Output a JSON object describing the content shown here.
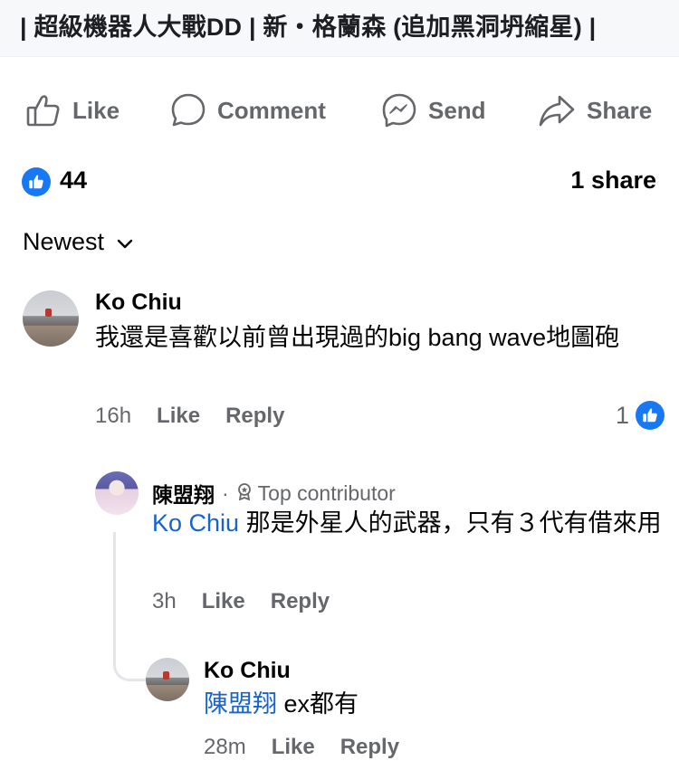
{
  "post": {
    "title": "| 超級機器人大戰DD | 新・格蘭森 (追加黑洞坍縮星) |"
  },
  "actions": {
    "like": "Like",
    "comment": "Comment",
    "send": "Send",
    "share": "Share"
  },
  "stats": {
    "reactions": "44",
    "shares": "1 share"
  },
  "sort": {
    "label": "Newest"
  },
  "comments": [
    {
      "author": "Ko Chiu",
      "text": "我還是喜歡以前曾出現過的big bang wave地圖砲",
      "time": "16h",
      "like": "Like",
      "reply": "Reply",
      "reactions": "1"
    },
    {
      "author": "陳盟翔",
      "separator": "·",
      "badge": "Top contributor",
      "mention": "Ko Chiu",
      "text": " 那是外星人的武器，只有３代有借來用",
      "time": "3h",
      "like": "Like",
      "reply": "Reply"
    },
    {
      "author": "Ko Chiu",
      "mention": "陳盟翔",
      "text": " ex都有",
      "time": "28m",
      "like": "Like",
      "reply": "Reply"
    }
  ],
  "colors": {
    "accent": "#1877f2",
    "mention": "#1763cf",
    "secondary_text": "#65676b"
  }
}
